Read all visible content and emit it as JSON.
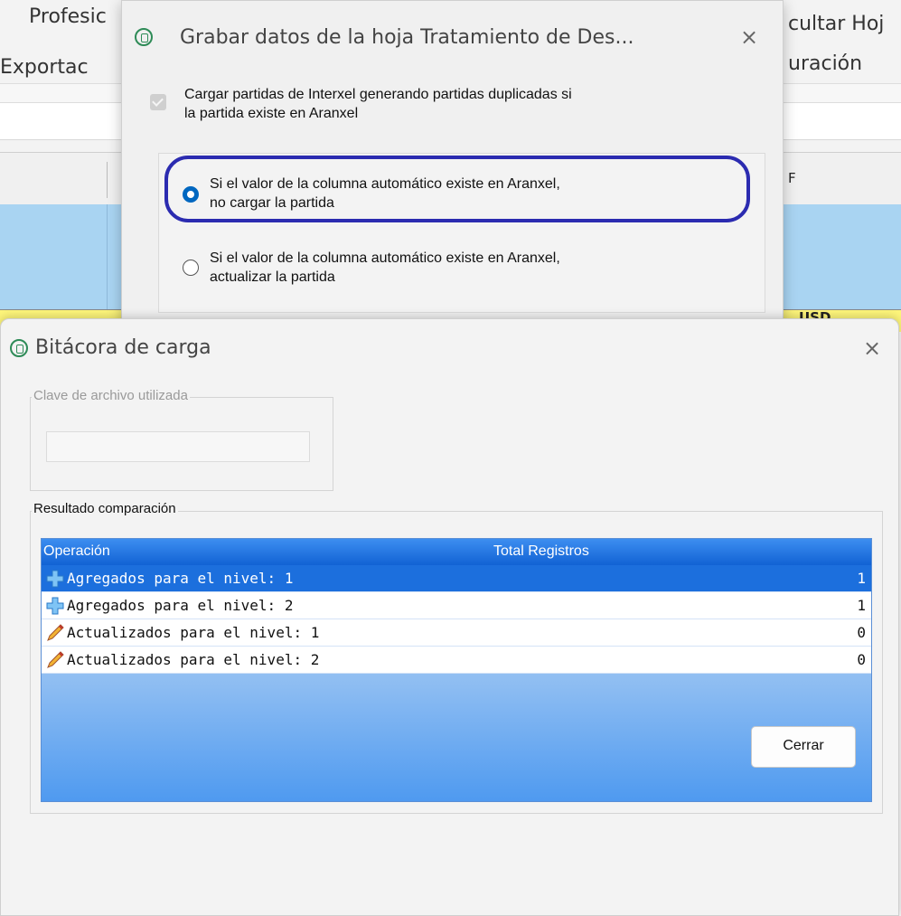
{
  "background": {
    "ribbon_text_1": "Profesic",
    "ribbon_text_2": "cultar Hoj",
    "ribbon_text_3": "Exportac",
    "ribbon_text_4": "uración",
    "column_letter": "F",
    "currency_cell": "USD"
  },
  "dialog_save": {
    "title": "Grabar datos de la hoja Tratamiento de Des...",
    "close_symbol": "×",
    "checkbox_label_line1": "Cargar partidas de Interxel generando partidas duplicadas si",
    "checkbox_label_line2": "la partida existe en Aranxel",
    "checkbox_checked": true,
    "option_1_line1": "Si el valor de la columna automático existe en Aranxel,",
    "option_1_line2": "no cargar la partida",
    "option_1_selected": true,
    "option_2_line1": "Si el valor de la columna automático existe en Aranxel,",
    "option_2_line2": "actualizar la partida",
    "option_2_selected": false
  },
  "dialog_log": {
    "title": "Bitácora de carga",
    "close_symbol": "×",
    "file_key_legend": "Clave de archivo utilizada",
    "file_key_value": "",
    "result_legend": "Resultado comparación",
    "grid_headers": {
      "operation": "Operación",
      "total": "Total Registros"
    },
    "rows": [
      {
        "icon": "plus-icon",
        "label": "Agregados para el nivel: 1",
        "value": "1",
        "selected": true
      },
      {
        "icon": "plus-icon",
        "label": "Agregados para el nivel: 2",
        "value": "1",
        "selected": false
      },
      {
        "icon": "pencil-icon",
        "label": "Actualizados para el nivel: 1",
        "value": "0",
        "selected": false
      },
      {
        "icon": "pencil-icon",
        "label": "Actualizados para el nivel: 2",
        "value": "0",
        "selected": false
      }
    ],
    "close_button": "Cerrar"
  },
  "colors": {
    "accent": "#0067c0",
    "highlight_ring": "#2b2bb0",
    "grid_header": "#1162d4",
    "selected_row": "#1c6fdd"
  }
}
